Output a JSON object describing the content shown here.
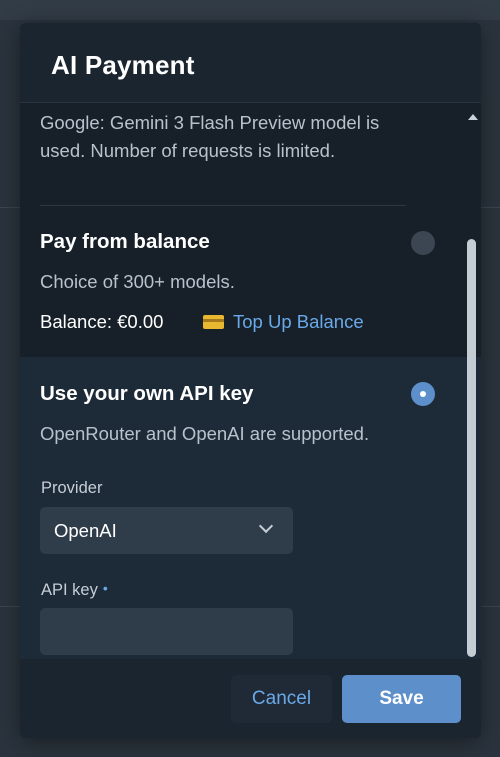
{
  "dialog": {
    "title": "AI Payment"
  },
  "free_option": {
    "description": "Google: Gemini 3 Flash Preview model is used. Number of requests is limited."
  },
  "balance_option": {
    "title": "Pay from balance",
    "subtitle": "Choice of 300+ models.",
    "balance_text": "Balance: €0.00",
    "topup_label": "Top Up Balance",
    "selected": false,
    "card_icon": "credit-card-icon"
  },
  "api_key_option": {
    "title": "Use your own API key",
    "subtitle": "OpenRouter and OpenAI are supported.",
    "selected": true,
    "provider_label": "Provider",
    "provider_value": "OpenAI",
    "api_key_label": "API key",
    "api_key_required_mark": "•",
    "api_key_value": ""
  },
  "footer": {
    "cancel_label": "Cancel",
    "save_label": "Save"
  },
  "colors": {
    "accent": "#5d90cb",
    "link": "#6aa9e9",
    "dialog_bg": "#172029",
    "selected_bg": "#1d2b38"
  }
}
